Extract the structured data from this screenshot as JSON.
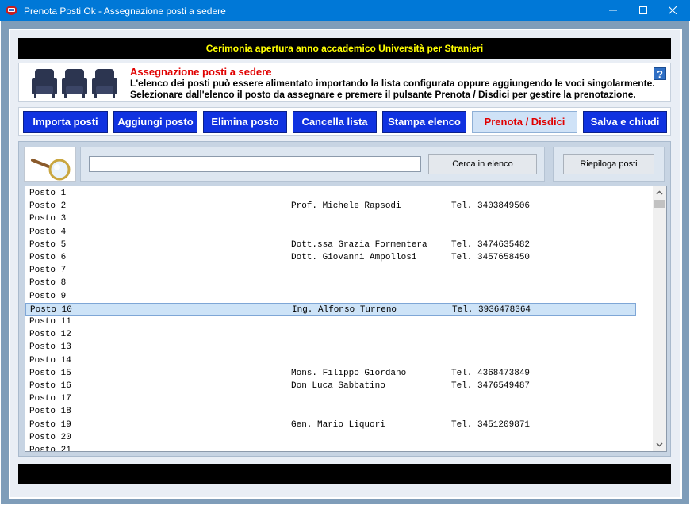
{
  "window": {
    "title": "Prenota Posti Ok - Assegnazione posti a sedere"
  },
  "header": {
    "event_title": "Cerimonia apertura anno accademico Università per Stranieri"
  },
  "info": {
    "title": "Assegnazione posti a sedere",
    "line1": "L'elenco dei posti può essere alimentato importando la lista configurata oppure aggiungendo le voci singolarmente.",
    "line2": "Selezionare dall'elenco il posto da assegnare e premere il pulsante Prenota / Disdici per gestire la prenotazione.",
    "help_label": "?"
  },
  "toolbar": {
    "import": "Importa posti",
    "add": "Aggiungi posto",
    "delete": "Elimina posto",
    "clear": "Cancella lista",
    "print": "Stampa elenco",
    "book": "Prenota / Disdici",
    "save": "Salva e chiudi"
  },
  "search": {
    "value": "",
    "placeholder": "",
    "search_button": "Cerca in elenco",
    "summary_button": "Riepiloga posti"
  },
  "list": {
    "selected_index": 9,
    "rows": [
      {
        "seat": "Posto 1",
        "name": "",
        "tel": ""
      },
      {
        "seat": "Posto 2",
        "name": "Prof. Michele Rapsodi",
        "tel": "Tel. 3403849506"
      },
      {
        "seat": "Posto 3",
        "name": "",
        "tel": ""
      },
      {
        "seat": "Posto 4",
        "name": "",
        "tel": ""
      },
      {
        "seat": "Posto 5",
        "name": "Dott.ssa Grazia Formentera",
        "tel": "Tel. 3474635482"
      },
      {
        "seat": "Posto 6",
        "name": "Dott. Giovanni Ampollosi",
        "tel": "Tel. 3457658450"
      },
      {
        "seat": "Posto 7",
        "name": "",
        "tel": ""
      },
      {
        "seat": "Posto 8",
        "name": "",
        "tel": ""
      },
      {
        "seat": "Posto 9",
        "name": "",
        "tel": ""
      },
      {
        "seat": "Posto 10",
        "name": "Ing. Alfonso Turreno",
        "tel": "Tel. 3936478364"
      },
      {
        "seat": "Posto 11",
        "name": "",
        "tel": ""
      },
      {
        "seat": "Posto 12",
        "name": "",
        "tel": ""
      },
      {
        "seat": "Posto 13",
        "name": "",
        "tel": ""
      },
      {
        "seat": "Posto 14",
        "name": "",
        "tel": ""
      },
      {
        "seat": "Posto 15",
        "name": "Mons. Filippo Giordano",
        "tel": "Tel. 4368473849"
      },
      {
        "seat": "Posto 16",
        "name": "Don Luca Sabbatino",
        "tel": "Tel. 3476549487"
      },
      {
        "seat": "Posto 17",
        "name": "",
        "tel": ""
      },
      {
        "seat": "Posto 18",
        "name": "",
        "tel": ""
      },
      {
        "seat": "Posto 19",
        "name": "Gen. Mario Liquori",
        "tel": "Tel. 3451209871"
      },
      {
        "seat": "Posto 20",
        "name": "",
        "tel": ""
      },
      {
        "seat": "Posto 21",
        "name": "",
        "tel": ""
      }
    ]
  },
  "colors": {
    "titlebar": "#0078d7",
    "button_blue": "#1032e0",
    "header_text": "#ffff00",
    "info_title": "#e00000",
    "selected_row": "#cde3f7"
  },
  "icons": [
    "app-icon",
    "minimize-icon",
    "maximize-icon",
    "close-icon",
    "armchair-icon",
    "help-icon",
    "magnifier-icon",
    "scroll-up-icon",
    "scroll-down-icon"
  ]
}
